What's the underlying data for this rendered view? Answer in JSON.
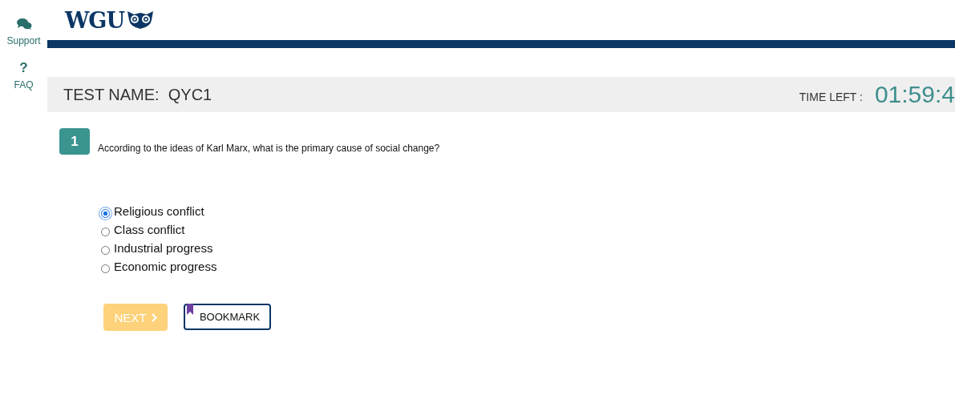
{
  "sidebar": {
    "items": [
      {
        "kind": "chat",
        "label": "Support"
      },
      {
        "kind": "help",
        "symbol": "?",
        "label": "FAQ"
      }
    ]
  },
  "header": {
    "logo": "WGU"
  },
  "test_bar": {
    "test_name": "TEST NAME:  QYC1",
    "time_label": "TIME LEFT :",
    "time": "01:59:4"
  },
  "question": {
    "number": "1",
    "text": "According to the ideas of Karl Marx, what is the primary cause of social change?",
    "options": [
      {
        "label": "Religious conflict",
        "selected": true
      },
      {
        "label": "Class conflict",
        "selected": false
      },
      {
        "label": "Industrial progress",
        "selected": false
      },
      {
        "label": "Economic progress",
        "selected": false
      }
    ]
  },
  "buttons": {
    "next": {
      "label": "NEXT",
      "disabled": true
    },
    "bookmark": {
      "label": "BOOKMARK"
    }
  }
}
